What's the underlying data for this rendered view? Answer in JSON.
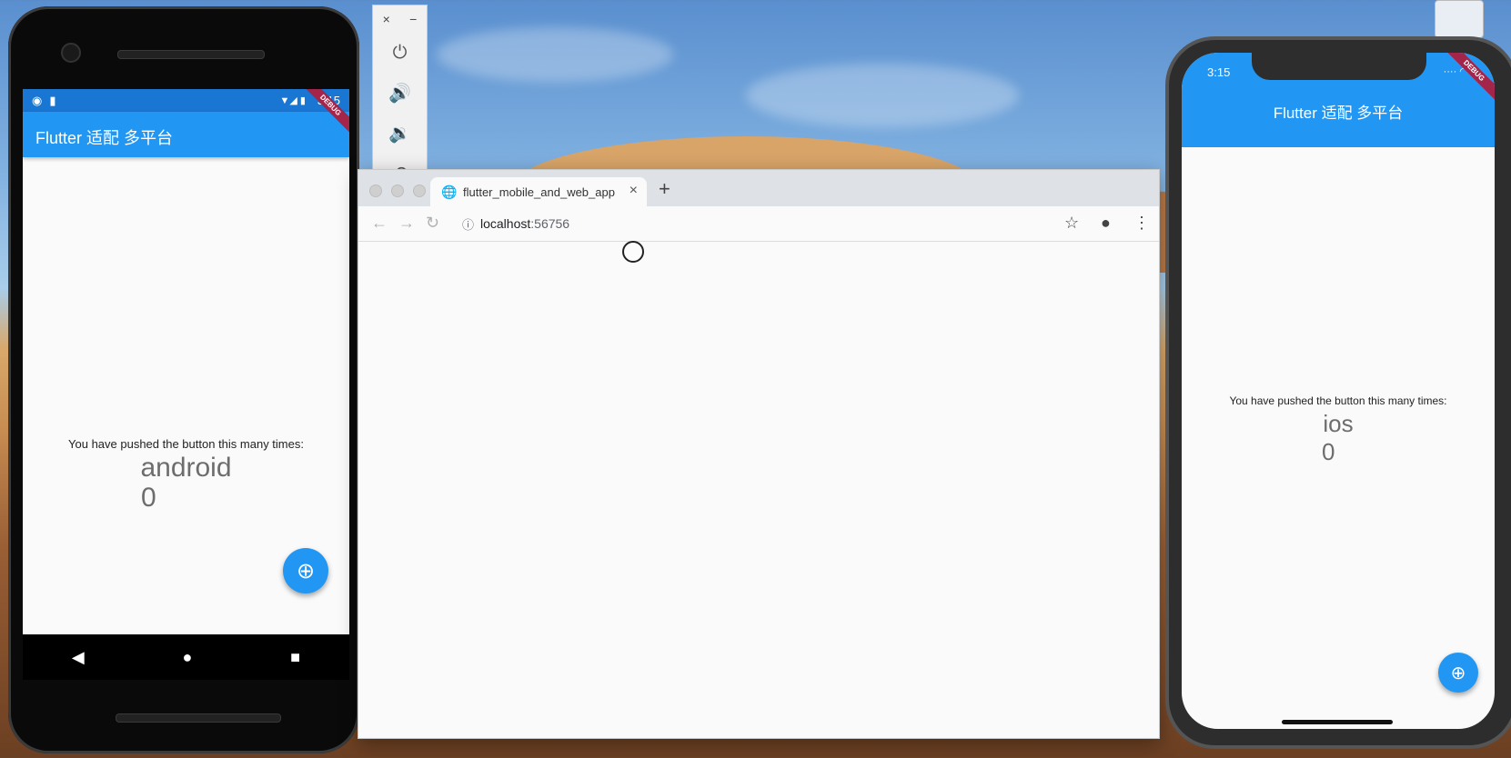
{
  "android": {
    "status_time": "3:15",
    "app_title": "Flutter 适配 多平台",
    "debug_label": "DEBUG",
    "message": "You have pushed the button this many times:",
    "platform": "android",
    "counter": "0",
    "fab_icon": "add-icon",
    "nav": {
      "back": "◀",
      "home": "●",
      "recents": "■"
    }
  },
  "emulator_panel": {
    "close": "×",
    "minimize": "−",
    "buttons": [
      "power-icon",
      "volume-up-icon",
      "volume-down-icon",
      "rotate-icon"
    ]
  },
  "browser": {
    "tab_title": "flutter_mobile_and_web_app",
    "url_host": "localhost",
    "url_port": ":56756",
    "colors": {
      "tabstrip": "#dee1e6",
      "page": "#fafafa"
    }
  },
  "ios": {
    "status_time": "3:15",
    "app_title": "Flutter 适配 多平台",
    "debug_label": "DEBUG",
    "message": "You have pushed the button this many times:",
    "platform": "ios",
    "counter": "0",
    "fab_icon": "add-icon"
  },
  "colors": {
    "primary": "#2196f3",
    "status_bar": "#1976d2",
    "debug_banner": "#a4254a"
  }
}
